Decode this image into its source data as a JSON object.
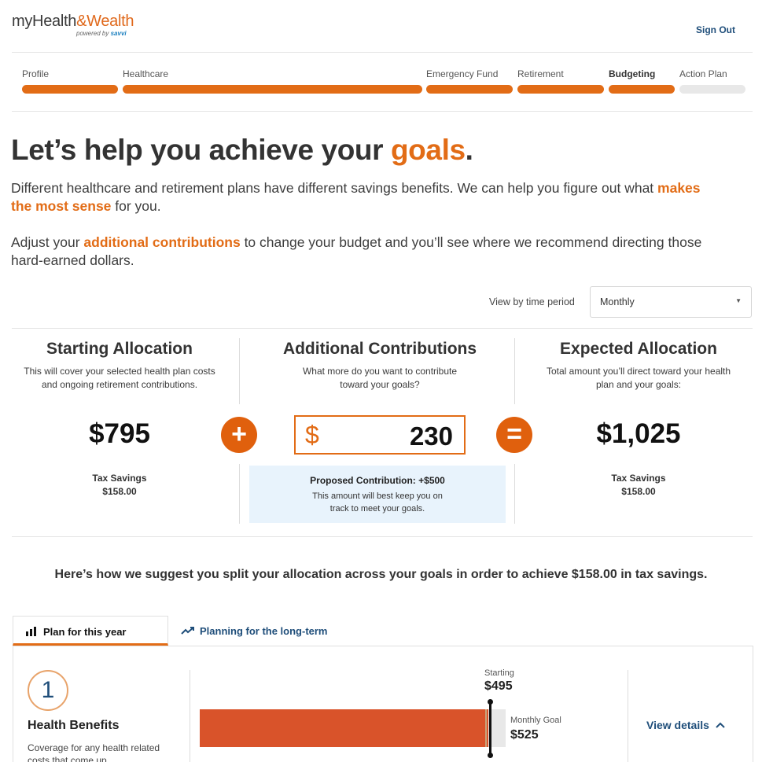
{
  "header": {
    "logo_main_a": "myHealth",
    "logo_main_b": "&Wealth",
    "logo_powered": "powered by",
    "logo_brand": "savvi",
    "sign_out": "Sign Out"
  },
  "steps": [
    {
      "label": "Profile",
      "state": "done"
    },
    {
      "label": "Healthcare",
      "state": "done"
    },
    {
      "label": "Emergency Fund",
      "state": "done"
    },
    {
      "label": "Retirement",
      "state": "done"
    },
    {
      "label": "Budgeting",
      "state": "current"
    },
    {
      "label": "Action Plan",
      "state": "todo"
    }
  ],
  "hero": {
    "title_pre": "Let’s help you achieve your ",
    "title_accent": "goals",
    "title_post": ".",
    "p1_pre": "Different healthcare and retirement plans have different savings benefits. We can help you figure out what ",
    "p1_accent": "makes the most sense",
    "p1_post": " for you.",
    "p2_pre": "Adjust your ",
    "p2_accent": "additional contributions",
    "p2_post": " to change your budget and you’ll see where we recommend directing those hard-earned dollars."
  },
  "time_period": {
    "label": "View by time period",
    "value": "Monthly"
  },
  "allocation": {
    "starting": {
      "title": "Starting Allocation",
      "desc": "This will cover your selected health plan costs  and ongoing retirement contributions.",
      "amount": "$795",
      "tax_label": "Tax Savings",
      "tax_value": "$158.00"
    },
    "additional": {
      "title": "Additional Contributions",
      "desc": "What more do you want to contribute toward your goals?",
      "currency": "$",
      "amount": "230",
      "proposed_title": "Proposed Contribution: +$500",
      "proposed_desc": "This amount will best keep you on track to meet your goals."
    },
    "expected": {
      "title": "Expected Allocation",
      "desc": "Total amount you’ll direct toward your health plan and your goals:",
      "amount": "$1,025",
      "tax_label": "Tax Savings",
      "tax_value": "$158.00"
    },
    "plus_symbol": "+",
    "equals_symbol": "="
  },
  "suggest_text": "Here’s how we suggest you split your allocation across your goals in order to achieve $158.00 in tax savings.",
  "tabs": [
    {
      "label": "Plan for this year",
      "icon": "bar-chart-icon",
      "active": true
    },
    {
      "label": "Planning for the long-term",
      "icon": "trend-up-icon",
      "active": false
    }
  ],
  "goal": {
    "number": "1",
    "title": "Health Benefits",
    "desc": "Coverage for any health related costs that come up.",
    "starting_label": "Starting",
    "starting_value": "$495",
    "goal_label": "Monthly Goal",
    "goal_value": "$525",
    "fill_fraction": 0.943,
    "view_details": "View details"
  },
  "colors": {
    "accent": "#e26c16",
    "link": "#1f4e7a",
    "bar": "#d9532a",
    "info_bg": "#e8f3fc"
  }
}
